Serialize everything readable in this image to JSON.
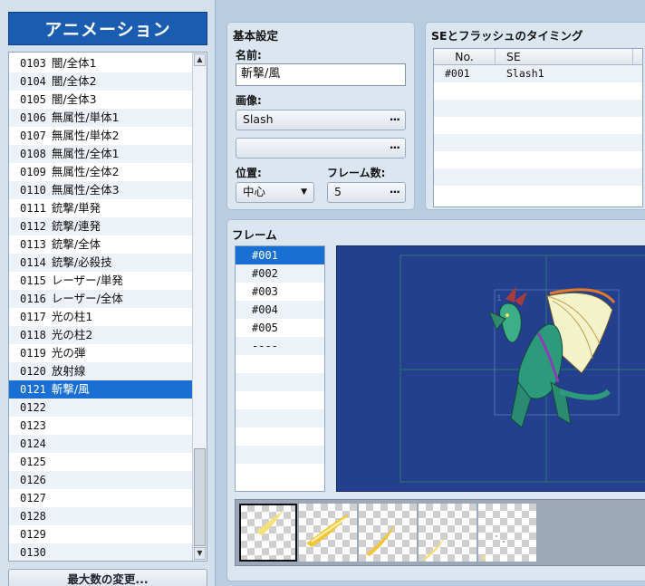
{
  "list_panel": {
    "title": "アニメーション",
    "items": [
      {
        "num": "0103",
        "name": "闇/全体1"
      },
      {
        "num": "0104",
        "name": "闇/全体2"
      },
      {
        "num": "0105",
        "name": "闇/全体3"
      },
      {
        "num": "0106",
        "name": "無属性/単体1"
      },
      {
        "num": "0107",
        "name": "無属性/単体2"
      },
      {
        "num": "0108",
        "name": "無属性/全体1"
      },
      {
        "num": "0109",
        "name": "無属性/全体2"
      },
      {
        "num": "0110",
        "name": "無属性/全体3"
      },
      {
        "num": "0111",
        "name": "銃撃/単発"
      },
      {
        "num": "0112",
        "name": "銃撃/連発"
      },
      {
        "num": "0113",
        "name": "銃撃/全体"
      },
      {
        "num": "0114",
        "name": "銃撃/必殺技"
      },
      {
        "num": "0115",
        "name": "レーザー/単発"
      },
      {
        "num": "0116",
        "name": "レーザー/全体"
      },
      {
        "num": "0117",
        "name": "光の柱1"
      },
      {
        "num": "0118",
        "name": "光の柱2"
      },
      {
        "num": "0119",
        "name": "光の弾"
      },
      {
        "num": "0120",
        "name": "放射線"
      },
      {
        "num": "0121",
        "name": "斬撃/風"
      },
      {
        "num": "0122",
        "name": ""
      },
      {
        "num": "0123",
        "name": ""
      },
      {
        "num": "0124",
        "name": ""
      },
      {
        "num": "0125",
        "name": ""
      },
      {
        "num": "0126",
        "name": ""
      },
      {
        "num": "0127",
        "name": ""
      },
      {
        "num": "0128",
        "name": ""
      },
      {
        "num": "0129",
        "name": ""
      },
      {
        "num": "0130",
        "name": ""
      }
    ],
    "selected_index": 18,
    "max_button_label": "最大数の変更..."
  },
  "basic_settings": {
    "title": "基本設定",
    "name_label": "名前:",
    "name_value": "斬撃/風",
    "image_label": "画像:",
    "image1_value": "Slash",
    "image2_value": "",
    "position_label": "位置:",
    "position_value": "中心",
    "frames_label": "フレーム数:",
    "frames_value": "5",
    "dots": "···"
  },
  "se_timing": {
    "title": "SEとフラッシュのタイミング",
    "col_no": "No.",
    "col_se": "SE",
    "rows": [
      {
        "no": "#001",
        "se": "Slash1"
      }
    ]
  },
  "frames": {
    "title": "フレーム",
    "items": [
      "#001",
      "#002",
      "#003",
      "#004",
      "#005",
      "----"
    ],
    "selected_index": 0,
    "canvas_target_label": "1"
  },
  "colors": {
    "accent": "#1a6fd3",
    "title_blue": "#1a5db0",
    "canvas_bg": "#233f8d"
  }
}
